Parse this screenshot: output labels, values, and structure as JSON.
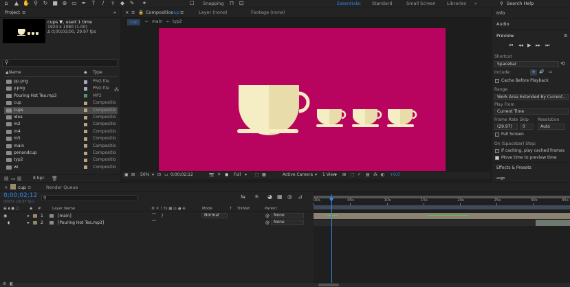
{
  "toolbar": {
    "snapping_label": "Snapping",
    "workspaces": [
      "Essentials",
      "Standard",
      "Small Screen",
      "Libraries"
    ],
    "search_label": "Search Help"
  },
  "project": {
    "tab_label": "Project",
    "selected_name": "cups ▼",
    "selected_usage": ", used 1 time",
    "resolution": "1920 x 1080 (1.00)",
    "duration": "Δ 0;00;03;00, 29.97 fps",
    "col_name": "Name",
    "col_type": "Type",
    "items": [
      {
        "name": "pp.png",
        "type": "PNG file",
        "kind": "png"
      },
      {
        "name": "y.png",
        "type": "PNG file",
        "kind": "png"
      },
      {
        "name": "Pouring Hot Tea.mp3",
        "type": "MP3",
        "kind": "mp3"
      },
      {
        "name": "cup",
        "type": "Compositio",
        "kind": "comp"
      },
      {
        "name": "cups",
        "type": "Compositio",
        "kind": "comp"
      },
      {
        "name": "idea",
        "type": "Compositio",
        "kind": "comp"
      },
      {
        "name": "m2",
        "type": "Compositio",
        "kind": "comp"
      },
      {
        "name": "m4",
        "type": "Compositio",
        "kind": "comp"
      },
      {
        "name": "m5",
        "type": "Compositio",
        "kind": "comp"
      },
      {
        "name": "main",
        "type": "Compositio",
        "kind": "comp"
      },
      {
        "name": "penandcup",
        "type": "Compositio",
        "kind": "comp"
      },
      {
        "name": "typ2",
        "type": "Compositio",
        "kind": "comp"
      },
      {
        "name": "wi",
        "type": "Compositio",
        "kind": "comp"
      }
    ],
    "bpc_label": "8 bpc"
  },
  "viewer": {
    "comp_tab_prefix": "Composition",
    "comp_tab_name": "cup",
    "layer_tab": "Layer (none)",
    "footage_tab": "Footage (none)",
    "breadcrumbs": [
      "cup",
      "main",
      "typ2"
    ],
    "zoom": "50%",
    "timecode": "0;00;02;12",
    "resolution": "Full",
    "camera": "Active Camera",
    "view": "1 View",
    "exposure": "+0.0",
    "comp_bg": "#b8045f",
    "cup_color": "#f5edc3"
  },
  "right": {
    "info_label": "Info",
    "audio_label": "Audio",
    "preview_label": "Preview",
    "shortcut_label": "Shortcut",
    "shortcut_value": "Spacebar",
    "include_label": "Include:",
    "cache_label": "Cache Before Playback",
    "range_label": "Range",
    "range_value": "Work Area Extended By Current...",
    "playfrom_label": "Play From",
    "playfrom_value": "Current Time",
    "framerate_label": "Frame Rate",
    "framerate_value": "(29.97)",
    "skip_label": "Skip",
    "skip_value": "0",
    "resolution_label": "Resolution",
    "resolution_value": "Auto",
    "fullscreen_label": "Full Screen",
    "stop_label": "On (Spacebar) Stop:",
    "ifcaching_label": "If caching, play cached frames",
    "movetime_label": "Move time to preview time",
    "effects_label": "Effects & Presets",
    "align_label": "Align"
  },
  "timeline": {
    "comp_tab": "cup",
    "render_tab": "Render Queue",
    "timecode": "0;00;02;12",
    "frames": "00072 (29.97 fps)",
    "col_layer": "Layer Name",
    "col_mode": "Mode",
    "col_t": "T",
    "col_trkmat": "TrkMat",
    "col_parent": "Parent",
    "layers": [
      {
        "num": "1",
        "name": "[main]",
        "mode": "Normal",
        "parent": "None"
      },
      {
        "num": "2",
        "name": "[Pouring Hot Tea.mp3]",
        "mode": "",
        "parent": "None"
      }
    ],
    "ruler": [
      "00s",
      "05s",
      "10s",
      "15s",
      "20s",
      "25s",
      "30s",
      "35s"
    ],
    "playhead_seconds": 2.4,
    "ruler_max_seconds": 35
  }
}
